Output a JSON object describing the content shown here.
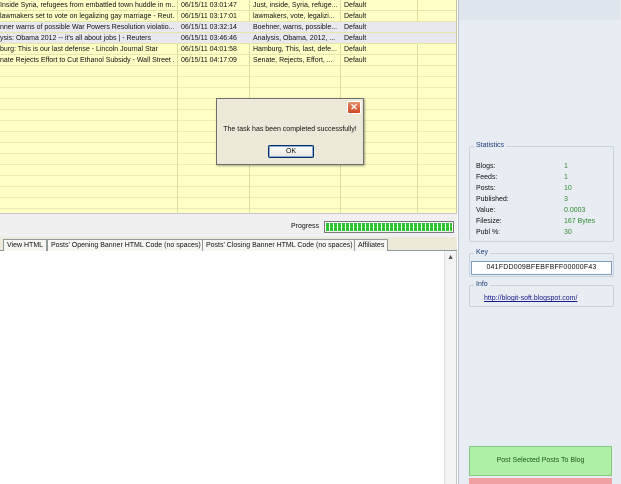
{
  "posts": [
    {
      "title": "Inside Syria, refugees from embattled town huddle in m...",
      "date": "06/15/11 03:01:47",
      "keywords": "Just, inside, Syria, refuge...",
      "category": "Default"
    },
    {
      "title": "lawmakers set to vote on legalizing gay marriage - Reut...",
      "date": "06/15/11 03:17:01",
      "keywords": "lawmakers, vote, legalizi...",
      "category": "Default"
    },
    {
      "title": "nner warns of possible War Powers Resolution violatio...",
      "date": "06/15/11 03:32:14",
      "keywords": "Boehner, warns, possible...",
      "category": "Default"
    },
    {
      "title": "ysis: Obama 2012 -- it's all about jobs | - Reuters",
      "date": "06/15/11 03:46:46",
      "keywords": "Analysis, Obama, 2012, ...",
      "category": "Default"
    },
    {
      "title": "burg: This is our last defense - Lincoln Journal Star",
      "date": "06/15/11 04:01:58",
      "keywords": "Hamburg, This, last, defe...",
      "category": "Default"
    },
    {
      "title": "nate Rejects Effort to Cut Ethanol Subsidy - Wall Street ...",
      "date": "06/15/11 04:17:09",
      "keywords": "Senate, Rejects, Effort, ...",
      "category": "Default"
    }
  ],
  "progress": {
    "label": "Progress",
    "value": 1.0
  },
  "tabs": [
    "View HTML",
    "Posts' Opening Banner HTML Code (no spaces)",
    "Posts' Closing Banner HTML Code (no spaces)",
    "Affiliates"
  ],
  "statistics": {
    "title": "Statistics",
    "rows": [
      {
        "label": "Blogs:",
        "value": "1"
      },
      {
        "label": "Feeds:",
        "value": "1"
      },
      {
        "label": "Posts:",
        "value": "10"
      },
      {
        "label": "Published:",
        "value": "3"
      },
      {
        "label": "Value:",
        "value": "0.0003"
      },
      {
        "label": "Filesize:",
        "value": "167 Bytes"
      },
      {
        "label": "Publ %:",
        "value": "30"
      }
    ]
  },
  "key": {
    "title": "Key",
    "value": "041FDD009BFEBFBFF00000F43"
  },
  "info": {
    "title": "Info",
    "link": "http://blogit-soft.blogspot.com/"
  },
  "post_button": "Post Selected Posts To Blog",
  "dialog": {
    "close_glyph": "✕",
    "message": "The task has been completed successfully!",
    "ok_label": "OK"
  },
  "colors": {
    "grid_bg": "#ffffc6",
    "progress_fill": "#2cc52c",
    "stat_value": "#2e8b2e",
    "post_button": "#aef0a6"
  }
}
